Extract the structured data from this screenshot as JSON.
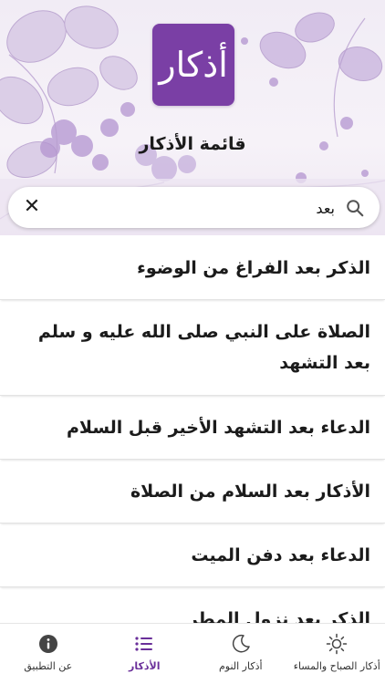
{
  "header": {
    "logo_text": "أذكار",
    "title": "قائمة الأذكار"
  },
  "search": {
    "value": "بعد",
    "close_symbol": "✕"
  },
  "results": [
    {
      "text": "الذكر بعد الفراغ من الوضوء"
    },
    {
      "text": "الصلاة على النبي صلى الله عليه و سلم بعد التشهد"
    },
    {
      "text": "الدعاء بعد التشهد الأخير قبل السلام"
    },
    {
      "text": "الأذكار بعد السلام من الصلاة"
    },
    {
      "text": "الدعاء بعد دفن الميت"
    },
    {
      "text": "الذكر بعد نزول المطر"
    }
  ],
  "nav": {
    "items": [
      {
        "label": "أذكار الصباح والمساء",
        "icon": "sun-icon"
      },
      {
        "label": "أذكار النوم",
        "icon": "moon-icon"
      },
      {
        "label": "الأذكار",
        "icon": "list-icon",
        "active": true
      },
      {
        "label": "عن التطبيق",
        "icon": "info-icon"
      }
    ]
  },
  "colors": {
    "accent": "#7a3fa5",
    "active_nav": "#6a2f9a",
    "header_bg": "#f1ecf5"
  }
}
